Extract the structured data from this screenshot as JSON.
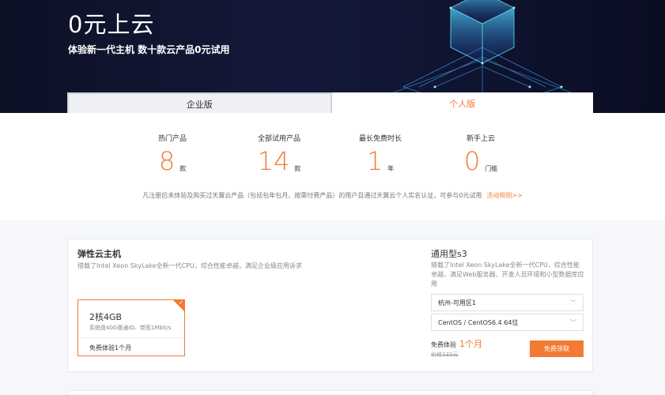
{
  "banner": {
    "title": "0元上云",
    "subtitle": "体验新一代主机 数十款云产品0元试用"
  },
  "tabs": [
    {
      "label": "企业版",
      "active": false
    },
    {
      "label": "个人版",
      "active": true
    }
  ],
  "stats": [
    {
      "label": "热门产品",
      "value": "8",
      "unit": "款"
    },
    {
      "label": "全部试用产品",
      "value": "14",
      "unit": "款"
    },
    {
      "label": "最长免费时长",
      "value": "1",
      "unit": "年"
    },
    {
      "label": "新手上云",
      "value": "0",
      "unit": "门槛"
    }
  ],
  "notice": {
    "text": "凡注册后未体验及购买过天翼云产品（包括包年包月、按需付费产品）的用户且通过天翼云个人实名认证，可参与0元试用",
    "link": "活动规则>>"
  },
  "product": {
    "title": "弹性云主机",
    "description": "搭载了Intel Xeon SkyLake全新一代CPU，综合性能卓越，满足企业级应用诉求",
    "spec": {
      "name": "2核4GB",
      "detail": "系统盘40G普通IO、带宽1Mbit/s",
      "trial": "免费体验1个月"
    },
    "type_title": "通用型s3",
    "type_desc": "搭载了Intel Xeon SkyLake全新一代CPU，综合性能卓越，满足Web服务器、开发人员环境和小型数据库应用",
    "region_select": "杭州-可用区1",
    "os_select": "CentOS / CentOS6.4 64位",
    "trial_label": "免费体验",
    "trial_value": "1个月",
    "original_price": "价格132元",
    "claim_button": "免费领取"
  },
  "colors": {
    "accent": "#f27a33",
    "banner_bg": "#0d1126",
    "page_bg": "#f5f7fa"
  }
}
